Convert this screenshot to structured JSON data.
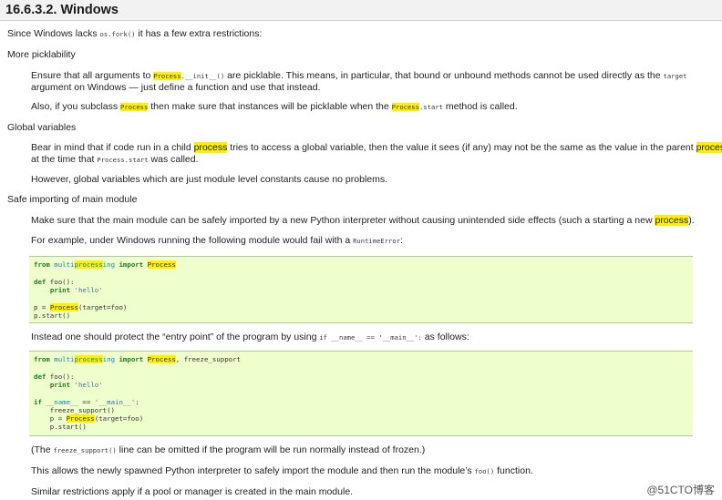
{
  "heading": "16.6.3.2. Windows",
  "intro": {
    "pre": "Since Windows lacks ",
    "code": "os.fork()",
    "post": " it has a few extra restrictions:"
  },
  "sec1": {
    "title": "More picklability",
    "p1a": {
      "pre": "Ensure that all arguments to ",
      "code1": "Process",
      "code2": ".__init__()",
      "post": " are picklable. This means, in particular, that bound or unbound methods cannot be used directly as the ",
      "code3": "target"
    },
    "p1b": "argument on Windows — just define a function and use that instead.",
    "p2": {
      "pre": "Also, if you subclass ",
      "code1": "Process",
      "mid": " then make sure that instances will be picklable when the ",
      "code2": "Process",
      "code3": ".start",
      "post": " method is called."
    }
  },
  "sec2": {
    "title": "Global variables",
    "p1a": {
      "pre": "Bear in mind that if code run in a child ",
      "w1": "process",
      "mid": " tries to access a global variable, then the value it sees (if any) may not be the same as the value in the parent ",
      "w2": "process"
    },
    "p1b": {
      "pre": "at the time that ",
      "code": "Process.start",
      "post": " was called."
    },
    "p2": "However, global variables which are just module level constants cause no problems."
  },
  "sec3": {
    "title": "Safe importing of main module",
    "p1": {
      "pre": "Make sure that the main module can be safely imported by a new Python interpreter without causing unintended side effects (such a starting a new ",
      "w": "process",
      "post": ")."
    },
    "p2": {
      "pre": "For example, under Windows running the following module would fail with a ",
      "code": "RuntimeError",
      "post": ":"
    }
  },
  "code1": {
    "l1": {
      "kw1": "from",
      "mod_a": " multi",
      "mod_b": "process",
      "mod_c": "ing ",
      "kw2": "import",
      "sp": " ",
      "cls": "Process"
    },
    "l2": {
      "kw": "def",
      "rest": " foo():"
    },
    "l3": {
      "indent": "    ",
      "kw": "print",
      "sp": " ",
      "str": "'hello'"
    },
    "l4": {
      "pre": "p = ",
      "cls": "Process",
      "post": "(target=foo)"
    },
    "l5": "p.start()"
  },
  "mid_para": {
    "pre": "Instead one should protect the “entry point” of the program by using ",
    "code": "if __name__ == '__main__':",
    "post": " as follows:"
  },
  "code2": {
    "l1": {
      "kw1": "from",
      "mod_a": " multi",
      "mod_b": "process",
      "mod_c": "ing ",
      "kw2": "import",
      "sp": " ",
      "cls": "Process",
      "post": ", freeze_support"
    },
    "l2": {
      "kw": "def",
      "rest": " foo():"
    },
    "l3": {
      "indent": "    ",
      "kw": "print",
      "sp": " ",
      "str": "'hello'"
    },
    "l4": {
      "kw": "if",
      "sp": " ",
      "name": "__name__",
      "op": " == ",
      "str": "'__main__'",
      "post": ":"
    },
    "l5": "    freeze_support()",
    "l6": {
      "pre": "    p = ",
      "cls": "Process",
      "post": "(target=foo)"
    },
    "l7": "    p.start()"
  },
  "after1": {
    "pre": "(The ",
    "code": "freeze_support()",
    "post": " line can be omitted if the program will be run normally instead of frozen.)"
  },
  "after2": {
    "pre": "This allows the newly spawned Python interpreter to safely import the module and then run the module’s ",
    "code": "foo()",
    "post": " function."
  },
  "after3": "Similar restrictions apply if a pool or manager is created in the main module.",
  "watermark": "@51CTO博客"
}
